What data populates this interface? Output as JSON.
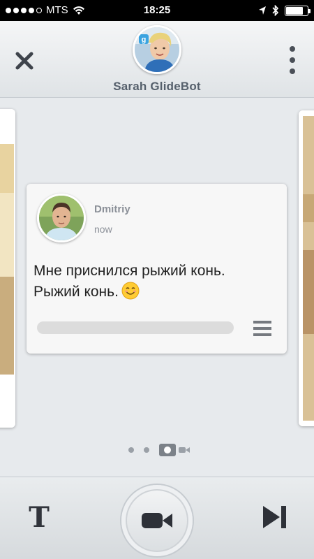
{
  "status_bar": {
    "carrier": "MTS",
    "time": "18:25",
    "signal_bars": 4,
    "battery_level": 0.8,
    "icons": [
      "signal-dots-icon",
      "wifi-icon",
      "location-arrow-icon",
      "bluetooth-icon",
      "battery-icon"
    ]
  },
  "header": {
    "title": "Sarah GlideBot",
    "close_icon": "close-icon",
    "more_icon": "more-vertical-icon",
    "avatar_badge": "g"
  },
  "message": {
    "sender": "Dmitriy",
    "time": "now",
    "text_line1": "Мне приснился рыжий конь.",
    "text_line2": "Рыжий конь.",
    "emoji": "smiling-face-emoji",
    "progress": 0.0,
    "menu_icon": "hamburger-menu-icon"
  },
  "pager": {
    "dots": 3,
    "current_icon": "photo-frame-icon",
    "next_icon": "video-camera-small-icon"
  },
  "bottom_bar": {
    "text_tool_label": "T",
    "record_icon": "video-camera-icon",
    "skip_icon": "skip-to-end-icon"
  },
  "colors": {
    "header_name": "#56606c",
    "meta_text": "#8b9098",
    "progress_track": "#dcdcdc",
    "background": "#e7eaed"
  }
}
